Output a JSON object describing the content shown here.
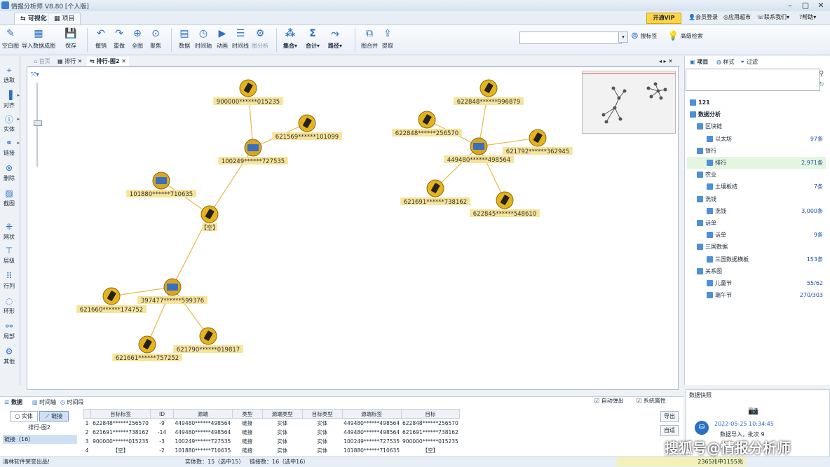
{
  "title_bar": {
    "app_title": "情报分析师 V8.80 [个人版]"
  },
  "top_tabs": [
    {
      "label": "可视化"
    },
    {
      "label": "项目"
    }
  ],
  "top_menu": {
    "vip": "开通VIP",
    "login": "会员登录",
    "appstore": "应用超市",
    "contact": "联系我们",
    "help": "帮助"
  },
  "ribbon": {
    "buttons": [
      {
        "label": "空白图"
      },
      {
        "label": "导入数据成图"
      },
      {
        "label": "保存"
      },
      {
        "label": "撤销"
      },
      {
        "label": "重做"
      },
      {
        "label": "全图"
      },
      {
        "label": "聚焦"
      },
      {
        "label": "数据"
      },
      {
        "label": "时间轴"
      },
      {
        "label": "动画"
      },
      {
        "label": "时间线"
      },
      {
        "label": "图分析"
      },
      {
        "label": "集合"
      },
      {
        "label": "合计"
      },
      {
        "label": "路径"
      },
      {
        "label": "图合并"
      },
      {
        "label": "提取"
      }
    ],
    "search_placeholder": "",
    "search_tag": "搜标签",
    "advanced_search": "高级检索"
  },
  "left_tools": [
    {
      "label": "选取"
    },
    {
      "label": "对齐"
    },
    {
      "label": "实体"
    },
    {
      "label": "链接"
    },
    {
      "label": "删除"
    },
    {
      "label": "截图"
    },
    {
      "label": "网状"
    },
    {
      "label": "层级"
    },
    {
      "label": "行列"
    },
    {
      "label": "环形"
    },
    {
      "label": "局部"
    },
    {
      "label": "其他"
    }
  ],
  "doc_tabs": [
    {
      "label": "首页"
    },
    {
      "label": "排行"
    },
    {
      "label": "排行-图2"
    }
  ],
  "graph": {
    "nodes": [
      {
        "label": "900000******015235",
        "kind": "phone"
      },
      {
        "label": "621569******101099",
        "kind": "phone"
      },
      {
        "label": "100249******727535",
        "kind": "card"
      },
      {
        "label": "101880******710635",
        "kind": "card"
      },
      {
        "label": "【空】",
        "kind": "phone"
      },
      {
        "label": "397477******599376",
        "kind": "card"
      },
      {
        "label": "621660******174752",
        "kind": "phone"
      },
      {
        "label": "621661******757252",
        "kind": "phone"
      },
      {
        "label": "621790******019817",
        "kind": "phone"
      },
      {
        "label": "622848******996879",
        "kind": "phone"
      },
      {
        "label": "622848******256570",
        "kind": "phone"
      },
      {
        "label": "449480******498564",
        "kind": "card"
      },
      {
        "label": "621792******362945",
        "kind": "phone"
      },
      {
        "label": "621691******738162",
        "kind": "phone"
      },
      {
        "label": "622845******548610",
        "kind": "phone"
      }
    ]
  },
  "right_panel": {
    "tabs": [
      {
        "label": "项目"
      },
      {
        "label": "样式"
      },
      {
        "label": "过滤"
      }
    ],
    "tree": [
      {
        "label": "121",
        "count": ""
      },
      {
        "label": "数据分析",
        "count": ""
      },
      {
        "label": "区块链",
        "count": ""
      },
      {
        "label": "以太坊",
        "count": "97条"
      },
      {
        "label": "银行",
        "count": ""
      },
      {
        "label": "排行",
        "count": "2,971条"
      },
      {
        "label": "农业",
        "count": ""
      },
      {
        "label": "土壤板结",
        "count": "7条"
      },
      {
        "label": "洗钱",
        "count": ""
      },
      {
        "label": "洗钱",
        "count": "3,000条"
      },
      {
        "label": "话单",
        "count": ""
      },
      {
        "label": "话单",
        "count": "9条"
      },
      {
        "label": "三国数据",
        "count": ""
      },
      {
        "label": "三国数据横板",
        "count": "153条"
      },
      {
        "label": "关系图",
        "count": ""
      },
      {
        "label": "儿童节",
        "count": "55/62"
      },
      {
        "label": "端午节",
        "count": "270/303"
      }
    ]
  },
  "bottom": {
    "tabs": [
      {
        "label": "数据"
      },
      {
        "label": "时间轴"
      },
      {
        "label": "时间段"
      }
    ],
    "filter_entity": "实体",
    "filter_link": "链接",
    "sheet_name": "排行-图2",
    "left_item": "链接（16）",
    "auto_popup": "自动弹出",
    "sys_attr": "系统属性",
    "export": "导出",
    "adapt": "自适",
    "columns": [
      "目标标签",
      "ID",
      "源端",
      "类型",
      "源端类型",
      "目标类型",
      "源端标签",
      "目标"
    ],
    "rows": [
      {
        "n": "1",
        "cells": [
          "622848******256570",
          "-9",
          "449480******498564",
          "链接",
          "实体",
          "实体",
          "449480******498564",
          "622848******256570"
        ]
      },
      {
        "n": "2",
        "cells": [
          "621691******738162",
          "-14",
          "449480******498564",
          "链接",
          "实体",
          "实体",
          "449480******498564",
          "621691******738162"
        ]
      },
      {
        "n": "3",
        "cells": [
          "900000******015235",
          "-3",
          "100249******727535",
          "链接",
          "实体",
          "实体",
          "100249******727535",
          "900000******015235"
        ]
      },
      {
        "n": "4",
        "cells": [
          "【空】",
          "-2",
          "101880******710635",
          "链接",
          "实体",
          "实体",
          "101880******710635",
          "【空】"
        ]
      }
    ]
  },
  "preview": {
    "title": "数据快照",
    "time": "2022-05-25 10:34:45",
    "desc": "数据导入，批次 9"
  },
  "status": {
    "left": "清林软件荣誉出品!",
    "entities": "实体数：15（选中15）",
    "links": "链接数：16（选中16）",
    "memory": "2365兆中1155兆"
  },
  "watermark": "搜狐号@情报分析师"
}
